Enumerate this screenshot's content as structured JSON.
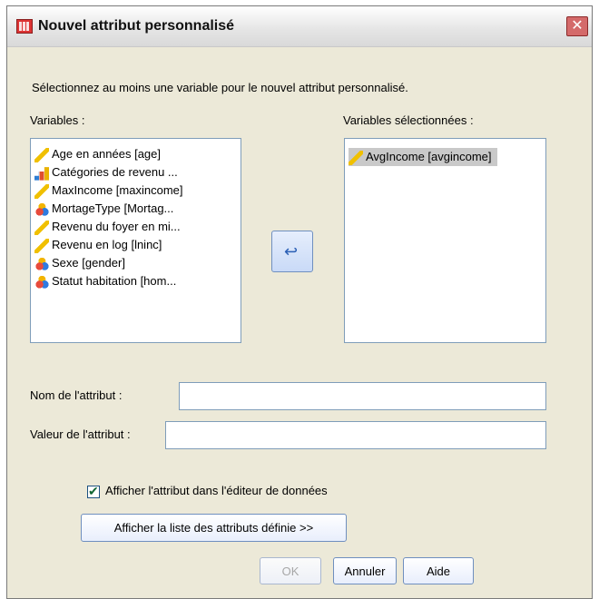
{
  "window": {
    "title": "Nouvel attribut personnalisé"
  },
  "instruction": "Sélectionnez au moins une variable pour le nouvel attribut personnalisé.",
  "labels": {
    "variables": "Variables :",
    "selected_variables": "Variables sélectionnées :",
    "attribute_name": "Nom de l'attribut :",
    "attribute_value": "Valeur de l'attribut :",
    "show_in_editor": "Afficher l'attribut dans l'éditeur de données"
  },
  "variables": [
    {
      "label": "Age en années [age]",
      "icon": "ruler-icon"
    },
    {
      "label": "Catégories de revenu ...",
      "icon": "bar-chart-icon"
    },
    {
      "label": "MaxIncome [maxincome]",
      "icon": "ruler-icon"
    },
    {
      "label": "MortageType [Mortag...",
      "icon": "nominal-icon"
    },
    {
      "label": "Revenu du foyer en mi...",
      "icon": "ruler-icon"
    },
    {
      "label": "Revenu en log [lninc]",
      "icon": "ruler-icon"
    },
    {
      "label": "Sexe [gender]",
      "icon": "nominal-icon"
    },
    {
      "label": "Statut habitation [hom...",
      "icon": "nominal-icon"
    }
  ],
  "selected_variables": [
    {
      "label": "AvgIncome [avgincome]",
      "icon": "ruler-icon"
    }
  ],
  "inputs": {
    "attribute_name": "",
    "attribute_value": ""
  },
  "checkbox": {
    "checked": true
  },
  "buttons": {
    "show_attributes": "Afficher la liste des attributs définie >>",
    "ok": "OK",
    "cancel": "Annuler",
    "help": "Aide"
  }
}
